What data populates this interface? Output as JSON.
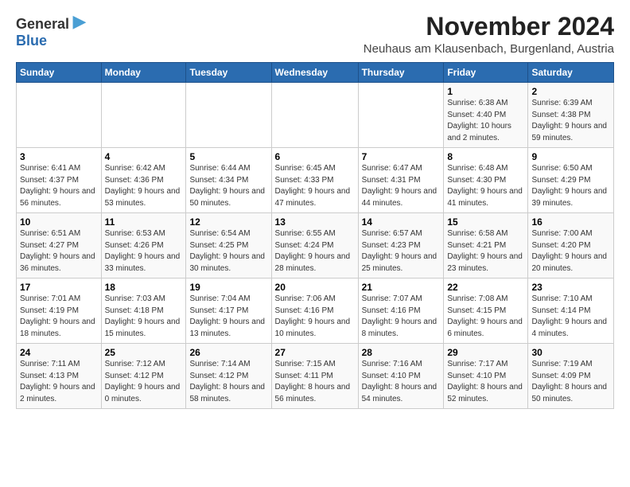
{
  "logo": {
    "general": "General",
    "blue": "Blue"
  },
  "title": "November 2024",
  "location": "Neuhaus am Klausenbach, Burgenland, Austria",
  "days_of_week": [
    "Sunday",
    "Monday",
    "Tuesday",
    "Wednesday",
    "Thursday",
    "Friday",
    "Saturday"
  ],
  "weeks": [
    [
      {
        "day": "",
        "info": ""
      },
      {
        "day": "",
        "info": ""
      },
      {
        "day": "",
        "info": ""
      },
      {
        "day": "",
        "info": ""
      },
      {
        "day": "",
        "info": ""
      },
      {
        "day": "1",
        "info": "Sunrise: 6:38 AM\nSunset: 4:40 PM\nDaylight: 10 hours and 2 minutes."
      },
      {
        "day": "2",
        "info": "Sunrise: 6:39 AM\nSunset: 4:38 PM\nDaylight: 9 hours and 59 minutes."
      }
    ],
    [
      {
        "day": "3",
        "info": "Sunrise: 6:41 AM\nSunset: 4:37 PM\nDaylight: 9 hours and 56 minutes."
      },
      {
        "day": "4",
        "info": "Sunrise: 6:42 AM\nSunset: 4:36 PM\nDaylight: 9 hours and 53 minutes."
      },
      {
        "day": "5",
        "info": "Sunrise: 6:44 AM\nSunset: 4:34 PM\nDaylight: 9 hours and 50 minutes."
      },
      {
        "day": "6",
        "info": "Sunrise: 6:45 AM\nSunset: 4:33 PM\nDaylight: 9 hours and 47 minutes."
      },
      {
        "day": "7",
        "info": "Sunrise: 6:47 AM\nSunset: 4:31 PM\nDaylight: 9 hours and 44 minutes."
      },
      {
        "day": "8",
        "info": "Sunrise: 6:48 AM\nSunset: 4:30 PM\nDaylight: 9 hours and 41 minutes."
      },
      {
        "day": "9",
        "info": "Sunrise: 6:50 AM\nSunset: 4:29 PM\nDaylight: 9 hours and 39 minutes."
      }
    ],
    [
      {
        "day": "10",
        "info": "Sunrise: 6:51 AM\nSunset: 4:27 PM\nDaylight: 9 hours and 36 minutes."
      },
      {
        "day": "11",
        "info": "Sunrise: 6:53 AM\nSunset: 4:26 PM\nDaylight: 9 hours and 33 minutes."
      },
      {
        "day": "12",
        "info": "Sunrise: 6:54 AM\nSunset: 4:25 PM\nDaylight: 9 hours and 30 minutes."
      },
      {
        "day": "13",
        "info": "Sunrise: 6:55 AM\nSunset: 4:24 PM\nDaylight: 9 hours and 28 minutes."
      },
      {
        "day": "14",
        "info": "Sunrise: 6:57 AM\nSunset: 4:23 PM\nDaylight: 9 hours and 25 minutes."
      },
      {
        "day": "15",
        "info": "Sunrise: 6:58 AM\nSunset: 4:21 PM\nDaylight: 9 hours and 23 minutes."
      },
      {
        "day": "16",
        "info": "Sunrise: 7:00 AM\nSunset: 4:20 PM\nDaylight: 9 hours and 20 minutes."
      }
    ],
    [
      {
        "day": "17",
        "info": "Sunrise: 7:01 AM\nSunset: 4:19 PM\nDaylight: 9 hours and 18 minutes."
      },
      {
        "day": "18",
        "info": "Sunrise: 7:03 AM\nSunset: 4:18 PM\nDaylight: 9 hours and 15 minutes."
      },
      {
        "day": "19",
        "info": "Sunrise: 7:04 AM\nSunset: 4:17 PM\nDaylight: 9 hours and 13 minutes."
      },
      {
        "day": "20",
        "info": "Sunrise: 7:06 AM\nSunset: 4:16 PM\nDaylight: 9 hours and 10 minutes."
      },
      {
        "day": "21",
        "info": "Sunrise: 7:07 AM\nSunset: 4:16 PM\nDaylight: 9 hours and 8 minutes."
      },
      {
        "day": "22",
        "info": "Sunrise: 7:08 AM\nSunset: 4:15 PM\nDaylight: 9 hours and 6 minutes."
      },
      {
        "day": "23",
        "info": "Sunrise: 7:10 AM\nSunset: 4:14 PM\nDaylight: 9 hours and 4 minutes."
      }
    ],
    [
      {
        "day": "24",
        "info": "Sunrise: 7:11 AM\nSunset: 4:13 PM\nDaylight: 9 hours and 2 minutes."
      },
      {
        "day": "25",
        "info": "Sunrise: 7:12 AM\nSunset: 4:12 PM\nDaylight: 9 hours and 0 minutes."
      },
      {
        "day": "26",
        "info": "Sunrise: 7:14 AM\nSunset: 4:12 PM\nDaylight: 8 hours and 58 minutes."
      },
      {
        "day": "27",
        "info": "Sunrise: 7:15 AM\nSunset: 4:11 PM\nDaylight: 8 hours and 56 minutes."
      },
      {
        "day": "28",
        "info": "Sunrise: 7:16 AM\nSunset: 4:10 PM\nDaylight: 8 hours and 54 minutes."
      },
      {
        "day": "29",
        "info": "Sunrise: 7:17 AM\nSunset: 4:10 PM\nDaylight: 8 hours and 52 minutes."
      },
      {
        "day": "30",
        "info": "Sunrise: 7:19 AM\nSunset: 4:09 PM\nDaylight: 8 hours and 50 minutes."
      }
    ]
  ]
}
